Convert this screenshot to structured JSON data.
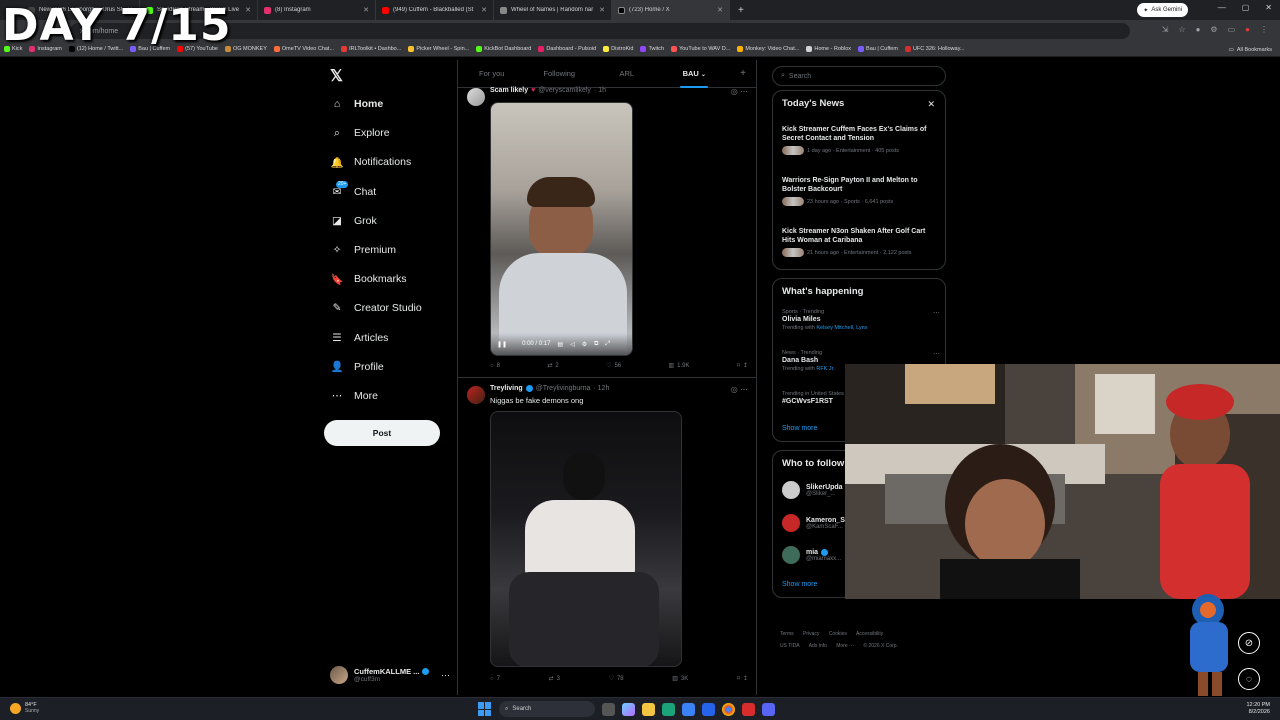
{
  "overlay": {
    "day_counter": "DAY 7/15"
  },
  "browser": {
    "tabs": [
      {
        "label": "New 2026 Lamborghini Urus Sl",
        "color": "#444"
      },
      {
        "label": "SquidRon Stream - Watch Live",
        "color": "#53fc18"
      },
      {
        "label": "(8) Instagram",
        "color": "#e1306c"
      },
      {
        "label": "(949) Cuffem - Blackballed (St",
        "color": "#ff0000"
      },
      {
        "label": "Wheel of Names | Random nar",
        "color": "#888"
      },
      {
        "label": "(723) Home / X",
        "color": "#000"
      }
    ],
    "active_tab_index": 5,
    "ask_gemini": "Ask Gemini",
    "url": "x.com/home",
    "bookmarks": [
      {
        "label": "Kick",
        "color": "#53fc18"
      },
      {
        "label": "Instagram",
        "color": "#e1306c"
      },
      {
        "label": "(12) Home / Twitt...",
        "color": "#000"
      },
      {
        "label": "Bau | Cuffem",
        "color": "#7a5cff"
      },
      {
        "label": "(57) YouTube",
        "color": "#ff0000"
      },
      {
        "label": "OG MONKEY",
        "color": "#c98a3a"
      },
      {
        "label": "OmeTV Video Chat...",
        "color": "#ff6b3a"
      },
      {
        "label": "IRLToolkit • Dashbo...",
        "color": "#e53935"
      },
      {
        "label": "Picker Wheel - Spin...",
        "color": "#fbc02d"
      },
      {
        "label": "KickBot Dashboard",
        "color": "#53fc18"
      },
      {
        "label": "Dashboard - Pulsoid",
        "color": "#e91e63"
      },
      {
        "label": "DistroKid",
        "color": "#ffeb3b"
      },
      {
        "label": "Twitch",
        "color": "#9146ff"
      },
      {
        "label": "YouTube to WAV D...",
        "color": "#ff5252"
      },
      {
        "label": "Monkey: Video Chat...",
        "color": "#ffb300"
      },
      {
        "label": "Home - Roblox",
        "color": "#cfd2d6"
      },
      {
        "label": "Bau | Cuffem",
        "color": "#7a5cff"
      },
      {
        "label": "UFC 326: Holloway...",
        "color": "#d32f2f"
      }
    ],
    "all_bookmarks": "All Bookmarks"
  },
  "nav": {
    "items": [
      {
        "label": "Home",
        "icon": "home-icon",
        "glyph": "⌂"
      },
      {
        "label": "Explore",
        "icon": "search-icon",
        "glyph": "⌕"
      },
      {
        "label": "Notifications",
        "icon": "bell-icon",
        "glyph": "🔔"
      },
      {
        "label": "Chat",
        "icon": "chat-icon",
        "glyph": "✉",
        "badge": "20+"
      },
      {
        "label": "Grok",
        "icon": "grok-icon",
        "glyph": "◪"
      },
      {
        "label": "Premium",
        "icon": "premium-icon",
        "glyph": "✧"
      },
      {
        "label": "Bookmarks",
        "icon": "bookmark-icon",
        "glyph": "🔖"
      },
      {
        "label": "Creator Studio",
        "icon": "creator-studio-icon",
        "glyph": "✎"
      },
      {
        "label": "Articles",
        "icon": "articles-icon",
        "glyph": "☰"
      },
      {
        "label": "Profile",
        "icon": "profile-icon",
        "glyph": "👤"
      },
      {
        "label": "More",
        "icon": "more-icon",
        "glyph": "⋯"
      }
    ],
    "post_label": "Post",
    "account": {
      "name": "CuffemKALLME ...",
      "handle": "@cuff3m"
    }
  },
  "timeline": {
    "tabs": [
      "For you",
      "Following",
      "ARL",
      "BAU"
    ],
    "active_tab": "BAU",
    "posts": [
      {
        "name": "Scam likely",
        "handle": "@veryscamlikely",
        "time": "· 1h",
        "text": "",
        "video_time": "0:00 / 0:17",
        "replies": "8",
        "reposts": "2",
        "likes": "56",
        "views": "1.9K"
      },
      {
        "name": "Treyliving",
        "handle": "@Treylivingburna",
        "time": "· 12h",
        "text": "Niggas be fake demons ong",
        "replies": "7",
        "reposts": "3",
        "likes": "78",
        "views": "3K"
      }
    ]
  },
  "sidebar": {
    "search_placeholder": "Search",
    "todays_news": {
      "title": "Today's News",
      "items": [
        {
          "headline": "Kick Streamer Cuffem Faces Ex's Claims of Secret Contact and Tension",
          "meta": "1 day ago · Entertainment · 405 posts"
        },
        {
          "headline": "Warriors Re-Sign Payton II and Melton to Bolster Backcourt",
          "meta": "23 hours ago · Sports · 6,641 posts"
        },
        {
          "headline": "Kick Streamer N3on Shaken After Golf Cart Hits Woman at Caribana",
          "meta": "21 hours ago · Entertainment · 2,122 posts"
        }
      ]
    },
    "whats_happening": {
      "title": "What's happening",
      "trends": [
        {
          "category": "Sports · Trending",
          "name": "Olivia Miles",
          "with_label": "Trending with",
          "with": "Kelsey Mitchell, Lynx"
        },
        {
          "category": "News · Trending",
          "name": "Dana Bash",
          "with_label": "Trending with",
          "with": "RFK Jr."
        },
        {
          "category": "Trending in United States",
          "name": "#GCWvsF1RST",
          "with_label": "",
          "with": ""
        }
      ],
      "show_more": "Show more"
    },
    "who_to_follow": {
      "title": "Who to follow",
      "accounts": [
        {
          "name": "SlikerUpda",
          "handle": "@Sliker_..."
        },
        {
          "name": "Kameron_S",
          "handle": "@KamScaF..."
        },
        {
          "name": "mia",
          "handle": "@miamaxx..."
        }
      ],
      "show_more": "Show more"
    },
    "footer": {
      "line1": [
        "Terms",
        "Privacy",
        "Cookies",
        "Accessibility"
      ],
      "line2": [
        "US TIDA",
        "Ads info",
        "More ···",
        "© 2026 X Corp."
      ]
    }
  },
  "taskbar": {
    "temp": "84°F",
    "weather": "Sunny",
    "search": "Search",
    "time": "12:20 PM",
    "date": "8/2/2026"
  }
}
